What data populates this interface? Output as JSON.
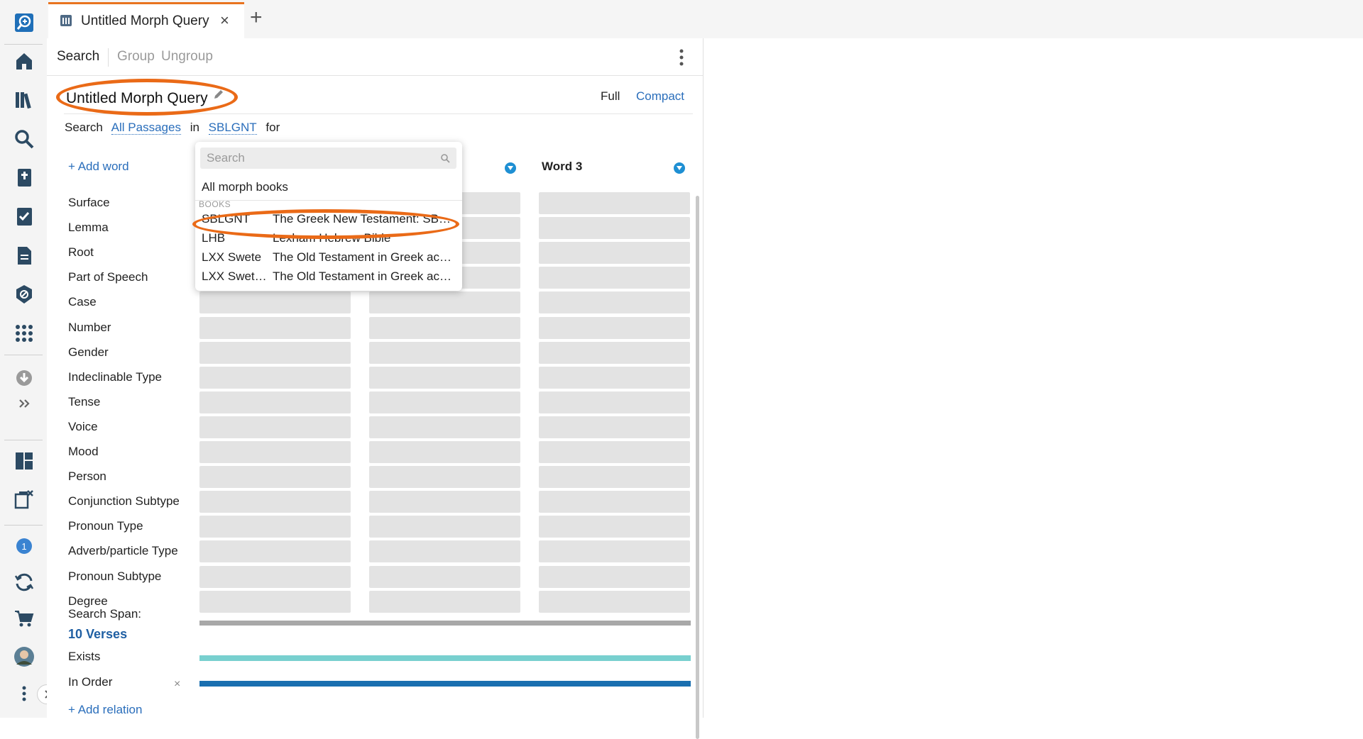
{
  "colors": {
    "accent": "#e8731f",
    "link": "#2a6ebb",
    "annotation": "#ea6a17",
    "exists_bar": "#78d0cf",
    "order_bar": "#1a6fb0",
    "span_bar": "#a8a8a8"
  },
  "rail": {
    "icons": [
      "logos-search-icon",
      "home-icon",
      "library-icon",
      "search-icon",
      "bible-icon",
      "checklist-icon",
      "document-icon",
      "shield-icon",
      "apps-grid-icon",
      "download-icon",
      "expand-icon",
      "layouts-icon",
      "close-panels-icon",
      "notifications-icon",
      "sync-icon",
      "cart-icon",
      "avatar",
      "more-icon"
    ],
    "notification_count": "1"
  },
  "tab": {
    "title": "Untitled Morph Query",
    "close": "×",
    "add": "+"
  },
  "toolbar": {
    "search": "Search",
    "group": "Group",
    "ungroup": "Ungroup"
  },
  "query": {
    "title": "Untitled Morph Query",
    "view_full": "Full",
    "view_compact": "Compact",
    "search_word": "Search",
    "range": "All Passages",
    "in_word": "in",
    "book": "SBLGNT",
    "for_word": "for"
  },
  "grid": {
    "add_word": "+ Add word",
    "column_header": "Word 3",
    "rows": [
      "Surface",
      "Lemma",
      "Root",
      "Part of Speech",
      "Case",
      "Number",
      "Gender",
      "Indeclinable Type",
      "Tense",
      "Voice",
      "Mood",
      "Person",
      "Conjunction Subtype",
      "Pronoun Type",
      "Adverb/particle Type",
      "Pronoun Subtype",
      "Degree"
    ],
    "search_span_label": "Search Span:",
    "search_span_value": "10 Verses",
    "exists": "Exists",
    "in_order": "In Order",
    "remove": "×",
    "add_relation": "+ Add relation"
  },
  "dropdown": {
    "search_placeholder": "Search",
    "all_books": "All morph books",
    "section": "BOOKS",
    "books": [
      {
        "abbr": "SBLGNT",
        "name": "The Greek New Testament: SBL Edition"
      },
      {
        "abbr": "LHB",
        "name": "Lexham Hebrew Bible"
      },
      {
        "abbr": "LXX Swete",
        "name": "The Old Testament in Greek according to the Septuagint"
      },
      {
        "abbr": "LXX Swete Apocrypha",
        "name": "The Old Testament in Greek according to the Septuagint"
      }
    ]
  }
}
